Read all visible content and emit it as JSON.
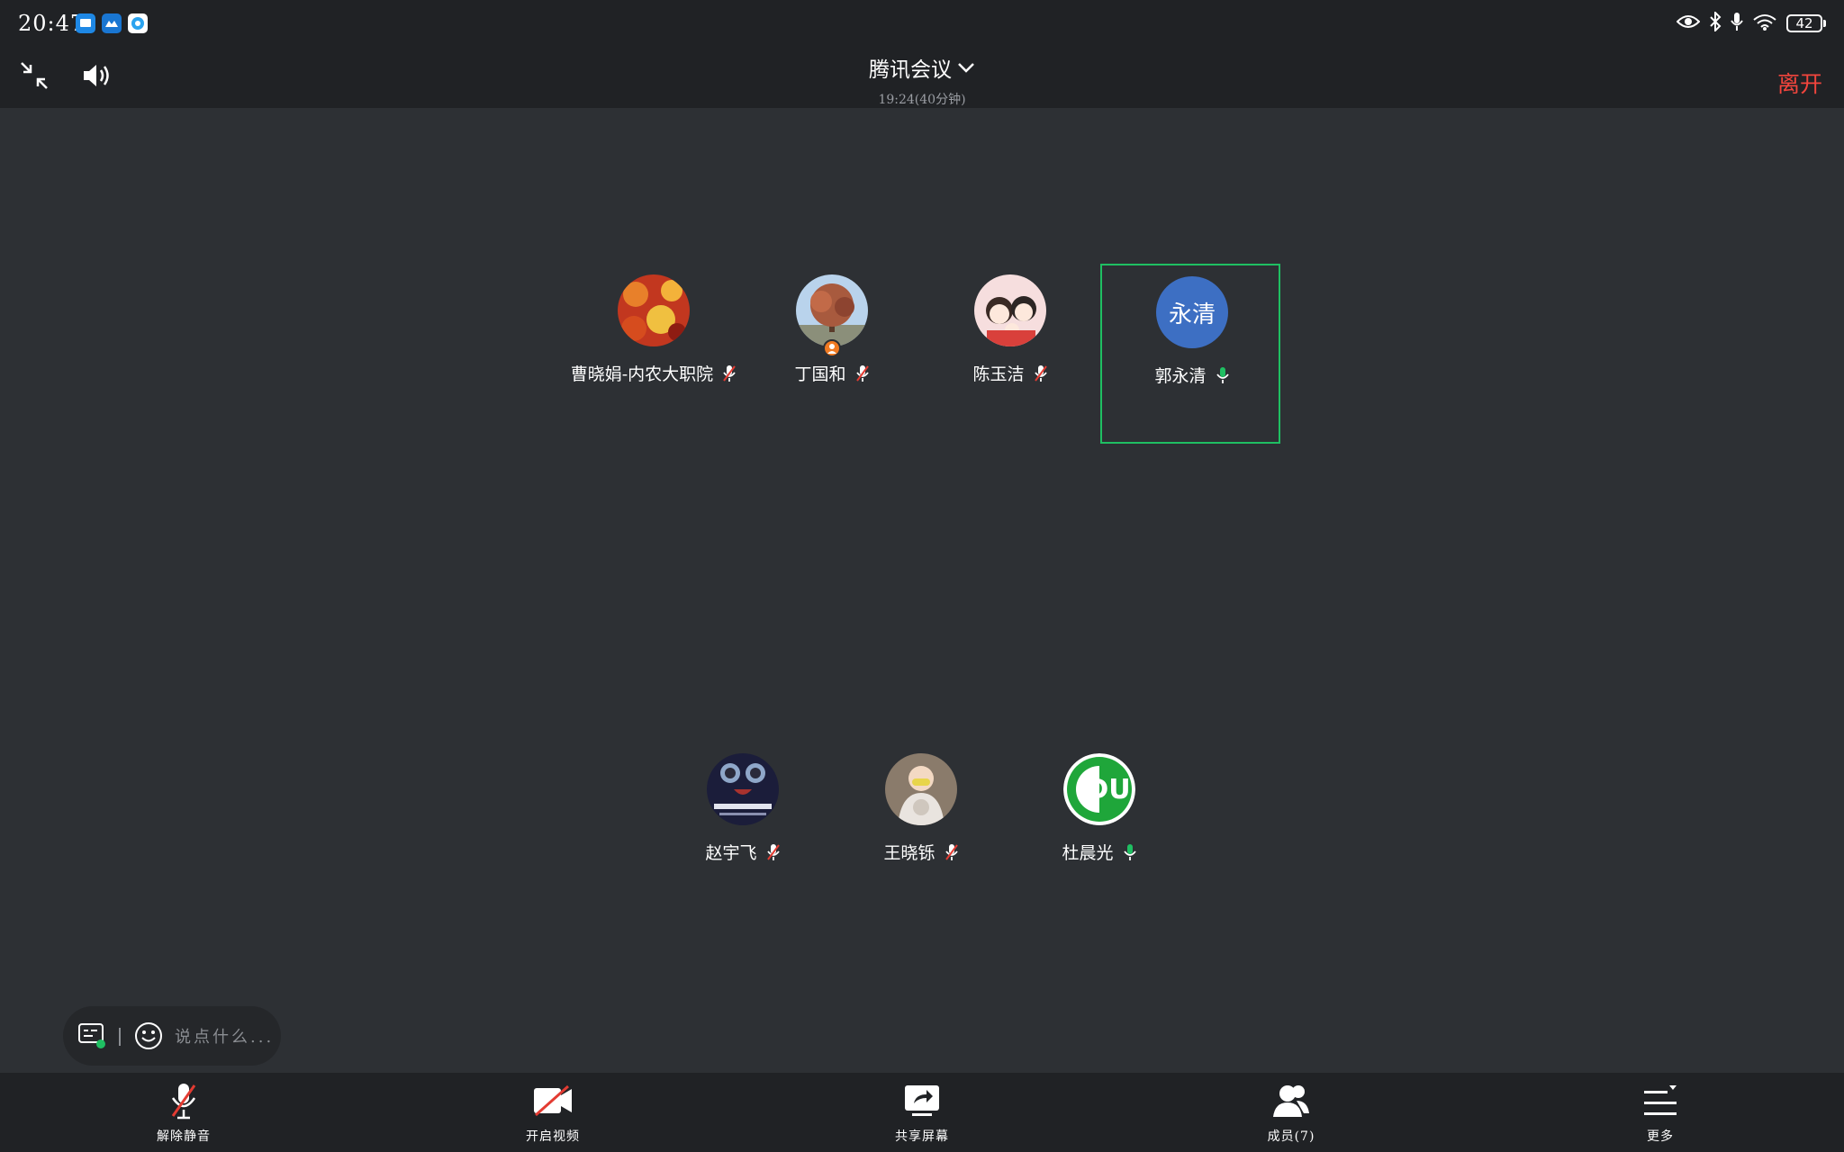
{
  "status_bar": {
    "time": "20:47",
    "battery": "42"
  },
  "header": {
    "title": "腾讯会议",
    "subtitle": "19:24(40分钟)",
    "leave_label": "离开"
  },
  "participants": [
    {
      "name": "曹晓娟-内农大职院",
      "mic": "muted"
    },
    {
      "name": "丁国和",
      "mic": "muted",
      "host": true
    },
    {
      "name": "陈玉洁",
      "mic": "muted"
    },
    {
      "name": "郭永清",
      "mic": "on",
      "avatar_text": "永清",
      "active_speaker": true
    },
    {
      "name": "赵宇飞",
      "mic": "muted"
    },
    {
      "name": "王晓铄",
      "mic": "muted"
    },
    {
      "name": "杜晨光",
      "mic": "on"
    }
  ],
  "chat": {
    "placeholder": "说点什么..."
  },
  "toolbar": {
    "unmute": "解除静音",
    "video": "开启视频",
    "share": "共享屏幕",
    "members": "成员(7)",
    "more": "更多"
  },
  "colors": {
    "accent_green": "#1fbf62",
    "leave_red": "#f2453d",
    "avatar_blue": "#3d6fc3"
  }
}
